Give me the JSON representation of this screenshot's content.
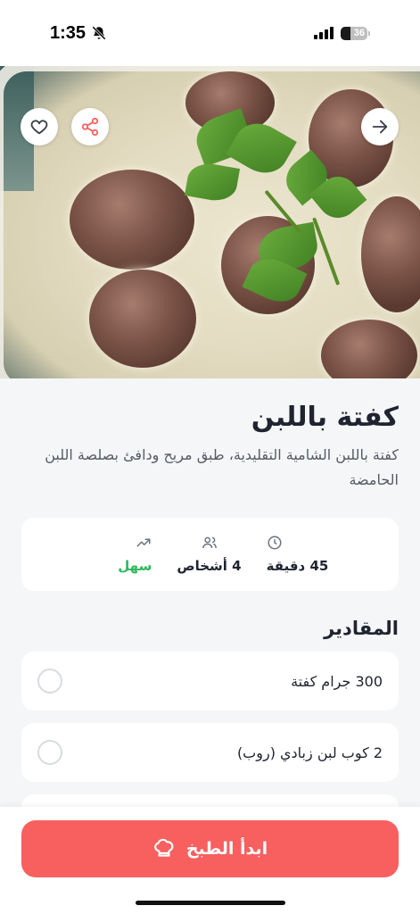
{
  "status_bar": {
    "time": "1:35",
    "battery": "36"
  },
  "hero": {
    "alt": "kofta in yogurt dish"
  },
  "recipe": {
    "title": "كفتة باللبن",
    "description": "كفتة باللبن الشامية التقليدية، طبق مريح ودافئ بصلصة اللبن الحامضة"
  },
  "stats": {
    "time": "45 دقيقة",
    "servings": "4 أشخاص",
    "difficulty": "سهل"
  },
  "ingredients": {
    "title": "المقادير",
    "items": [
      {
        "text": "300 جرام كفتة"
      },
      {
        "text": "2 كوب لبن زبادي (روب)"
      }
    ]
  },
  "actions": {
    "start_cooking": "ابدأ الطبخ"
  },
  "colors": {
    "accent": "#f7605f",
    "easy": "#2eb85c",
    "background": "#f5f6f8"
  }
}
